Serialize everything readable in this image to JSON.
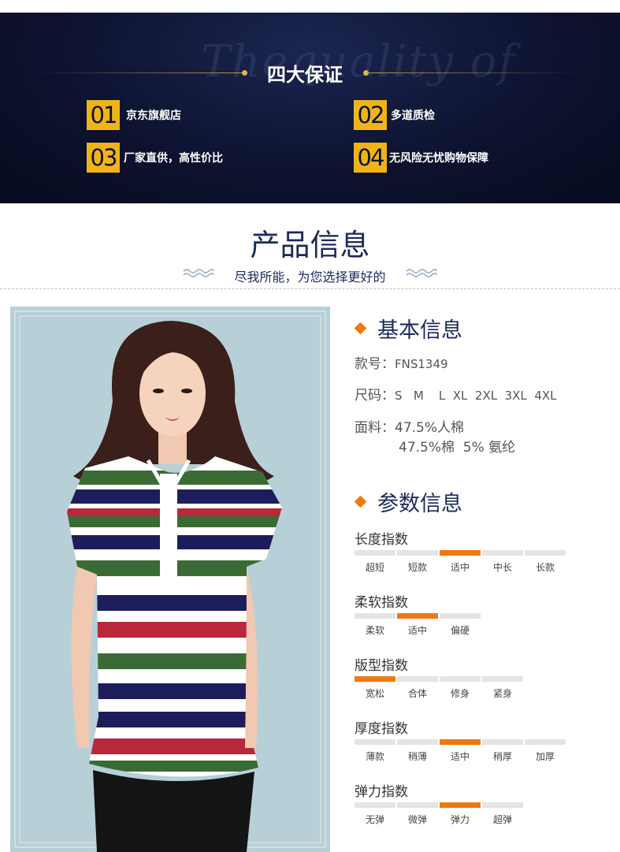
{
  "banner": {
    "script_text": "Thequality of",
    "title": "四大保证",
    "items": [
      {
        "num": "01",
        "text": "京东旗舰店"
      },
      {
        "num": "02",
        "text": "多道质检"
      },
      {
        "num": "03",
        "text": "厂家直供，高性价比"
      },
      {
        "num": "04",
        "text": "无风险无忧购物保障"
      }
    ]
  },
  "section": {
    "title": "产品信息",
    "subtitle": "尽我所能，为您选择更好的"
  },
  "basic": {
    "heading": "基本信息",
    "model_label": "款号：",
    "model_value": "FNS1349",
    "size_label": "尺码：",
    "size_value": "S   M    L  XL  2XL  3XL  4XL",
    "fabric_label": "面料：",
    "fabric_line1": "47.5%人棉",
    "fabric_line2": "47.5%棉  5% 氨纶"
  },
  "params": {
    "heading": "参数信息",
    "gauges": [
      {
        "title": "长度指数",
        "options": [
          "超短",
          "短款",
          "适中",
          "中长",
          "长款"
        ],
        "selected": 2
      },
      {
        "title": "柔软指数",
        "options": [
          "柔软",
          "适中",
          "偏硬"
        ],
        "selected": 1
      },
      {
        "title": "版型指数",
        "options": [
          "宽松",
          "合体",
          "修身",
          "紧身"
        ],
        "selected": 0
      },
      {
        "title": "厚度指数",
        "options": [
          "薄款",
          "稍薄",
          "适中",
          "稍厚",
          "加厚"
        ],
        "selected": 2
      },
      {
        "title": "弹力指数",
        "options": [
          "无弹",
          "微弹",
          "弹力",
          "超弹"
        ],
        "selected": 2
      }
    ]
  },
  "colors": {
    "accent": "#f0780e",
    "banner_number_bg": "#f0b419",
    "heading_navy": "#1b2a5a",
    "stripe_navy": "#1e1d5c",
    "stripe_red": "#b8283a",
    "stripe_green": "#3b6b34"
  }
}
